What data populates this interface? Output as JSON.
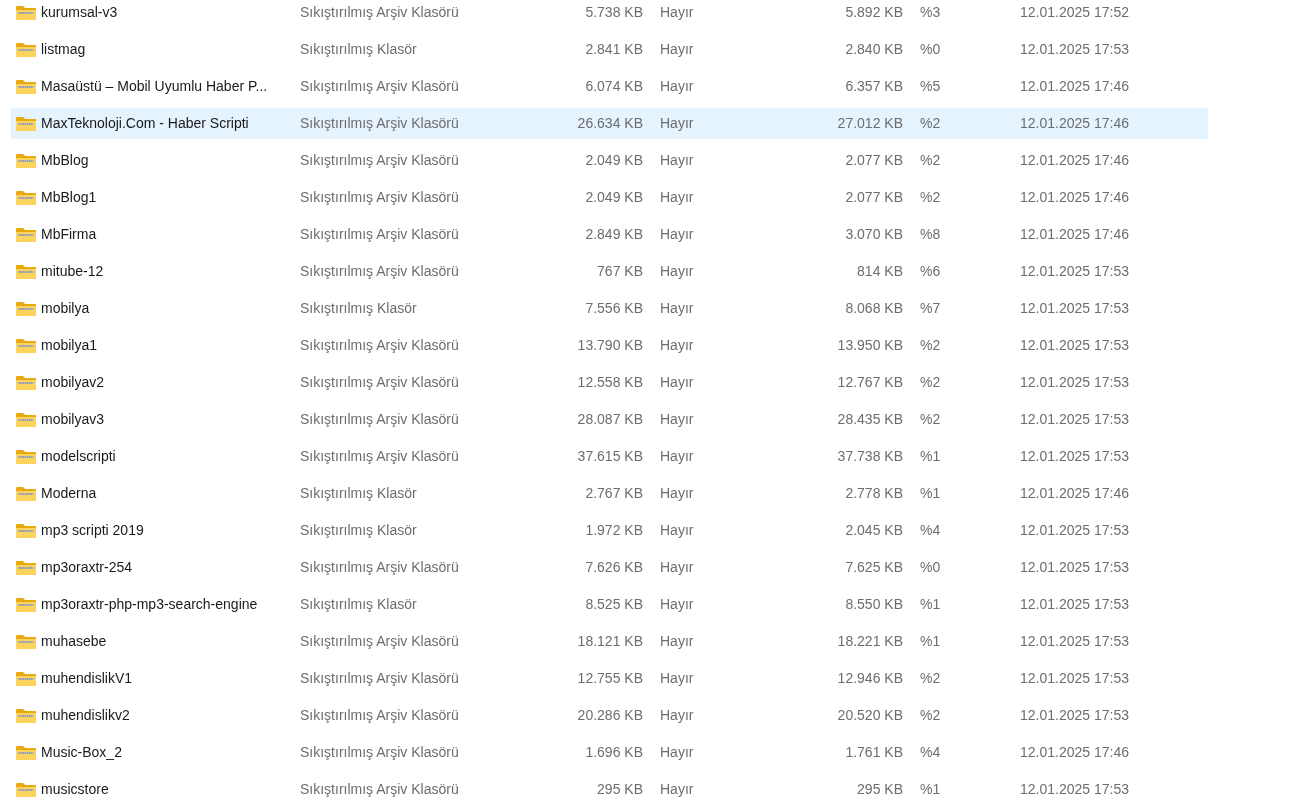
{
  "files": [
    {
      "name": "kurumsal-v3",
      "type": "Sıkıştırılmış Arşiv Klasörü",
      "size": "5.738 KB",
      "protected": "Hayır",
      "packed": "5.892 KB",
      "ratio": "%3",
      "date": "12.01.2025 17:52",
      "selected": false
    },
    {
      "name": "listmag",
      "type": "Sıkıştırılmış Klasör",
      "size": "2.841 KB",
      "protected": "Hayır",
      "packed": "2.840 KB",
      "ratio": "%0",
      "date": "12.01.2025 17:53",
      "selected": false
    },
    {
      "name": "Masaüstü – Mobil Uyumlu Haber P...",
      "type": "Sıkıştırılmış Arşiv Klasörü",
      "size": "6.074 KB",
      "protected": "Hayır",
      "packed": "6.357 KB",
      "ratio": "%5",
      "date": "12.01.2025 17:46",
      "selected": false
    },
    {
      "name": "MaxTeknoloji.Com - Haber Scripti",
      "type": "Sıkıştırılmış Arşiv Klasörü",
      "size": "26.634 KB",
      "protected": "Hayır",
      "packed": "27.012 KB",
      "ratio": "%2",
      "date": "12.01.2025 17:46",
      "selected": true
    },
    {
      "name": "MbBlog",
      "type": "Sıkıştırılmış Arşiv Klasörü",
      "size": "2.049 KB",
      "protected": "Hayır",
      "packed": "2.077 KB",
      "ratio": "%2",
      "date": "12.01.2025 17:46",
      "selected": false
    },
    {
      "name": "MbBlog1",
      "type": "Sıkıştırılmış Arşiv Klasörü",
      "size": "2.049 KB",
      "protected": "Hayır",
      "packed": "2.077 KB",
      "ratio": "%2",
      "date": "12.01.2025 17:46",
      "selected": false
    },
    {
      "name": "MbFirma",
      "type": "Sıkıştırılmış Arşiv Klasörü",
      "size": "2.849 KB",
      "protected": "Hayır",
      "packed": "3.070 KB",
      "ratio": "%8",
      "date": "12.01.2025 17:46",
      "selected": false
    },
    {
      "name": "mitube-12",
      "type": "Sıkıştırılmış Arşiv Klasörü",
      "size": "767 KB",
      "protected": "Hayır",
      "packed": "814 KB",
      "ratio": "%6",
      "date": "12.01.2025 17:53",
      "selected": false
    },
    {
      "name": "mobilya",
      "type": "Sıkıştırılmış Klasör",
      "size": "7.556 KB",
      "protected": "Hayır",
      "packed": "8.068 KB",
      "ratio": "%7",
      "date": "12.01.2025 17:53",
      "selected": false
    },
    {
      "name": "mobilya1",
      "type": "Sıkıştırılmış Arşiv Klasörü",
      "size": "13.790 KB",
      "protected": "Hayır",
      "packed": "13.950 KB",
      "ratio": "%2",
      "date": "12.01.2025 17:53",
      "selected": false
    },
    {
      "name": "mobilyav2",
      "type": "Sıkıştırılmış Arşiv Klasörü",
      "size": "12.558 KB",
      "protected": "Hayır",
      "packed": "12.767 KB",
      "ratio": "%2",
      "date": "12.01.2025 17:53",
      "selected": false
    },
    {
      "name": "mobilyav3",
      "type": "Sıkıştırılmış Arşiv Klasörü",
      "size": "28.087 KB",
      "protected": "Hayır",
      "packed": "28.435 KB",
      "ratio": "%2",
      "date": "12.01.2025 17:53",
      "selected": false
    },
    {
      "name": "modelscripti",
      "type": "Sıkıştırılmış Arşiv Klasörü",
      "size": "37.615 KB",
      "protected": "Hayır",
      "packed": "37.738 KB",
      "ratio": "%1",
      "date": "12.01.2025 17:53",
      "selected": false
    },
    {
      "name": "Moderna",
      "type": "Sıkıştırılmış Klasör",
      "size": "2.767 KB",
      "protected": "Hayır",
      "packed": "2.778 KB",
      "ratio": "%1",
      "date": "12.01.2025 17:46",
      "selected": false
    },
    {
      "name": "mp3 scripti 2019",
      "type": "Sıkıştırılmış Klasör",
      "size": "1.972 KB",
      "protected": "Hayır",
      "packed": "2.045 KB",
      "ratio": "%4",
      "date": "12.01.2025 17:53",
      "selected": false
    },
    {
      "name": "mp3oraxtr-254",
      "type": "Sıkıştırılmış Arşiv Klasörü",
      "size": "7.626 KB",
      "protected": "Hayır",
      "packed": "7.625 KB",
      "ratio": "%0",
      "date": "12.01.2025 17:53",
      "selected": false
    },
    {
      "name": "mp3oraxtr-php-mp3-search-engine",
      "type": "Sıkıştırılmış Klasör",
      "size": "8.525 KB",
      "protected": "Hayır",
      "packed": "8.550 KB",
      "ratio": "%1",
      "date": "12.01.2025 17:53",
      "selected": false
    },
    {
      "name": "muhasebe",
      "type": "Sıkıştırılmış Arşiv Klasörü",
      "size": "18.121 KB",
      "protected": "Hayır",
      "packed": "18.221 KB",
      "ratio": "%1",
      "date": "12.01.2025 17:53",
      "selected": false
    },
    {
      "name": "muhendislikV1",
      "type": "Sıkıştırılmış Arşiv Klasörü",
      "size": "12.755 KB",
      "protected": "Hayır",
      "packed": "12.946 KB",
      "ratio": "%2",
      "date": "12.01.2025 17:53",
      "selected": false
    },
    {
      "name": "muhendislikv2",
      "type": "Sıkıştırılmış Arşiv Klasörü",
      "size": "20.286 KB",
      "protected": "Hayır",
      "packed": "20.520 KB",
      "ratio": "%2",
      "date": "12.01.2025 17:53",
      "selected": false
    },
    {
      "name": "Music-Box_2",
      "type": "Sıkıştırılmış Arşiv Klasörü",
      "size": "1.696 KB",
      "protected": "Hayır",
      "packed": "1.761 KB",
      "ratio": "%4",
      "date": "12.01.2025 17:46",
      "selected": false
    },
    {
      "name": "musicstore",
      "type": "Sıkıştırılmış Arşiv Klasörü",
      "size": "295 KB",
      "protected": "Hayır",
      "packed": "295 KB",
      "ratio": "%1",
      "date": "12.01.2025 17:53",
      "selected": false
    }
  ]
}
